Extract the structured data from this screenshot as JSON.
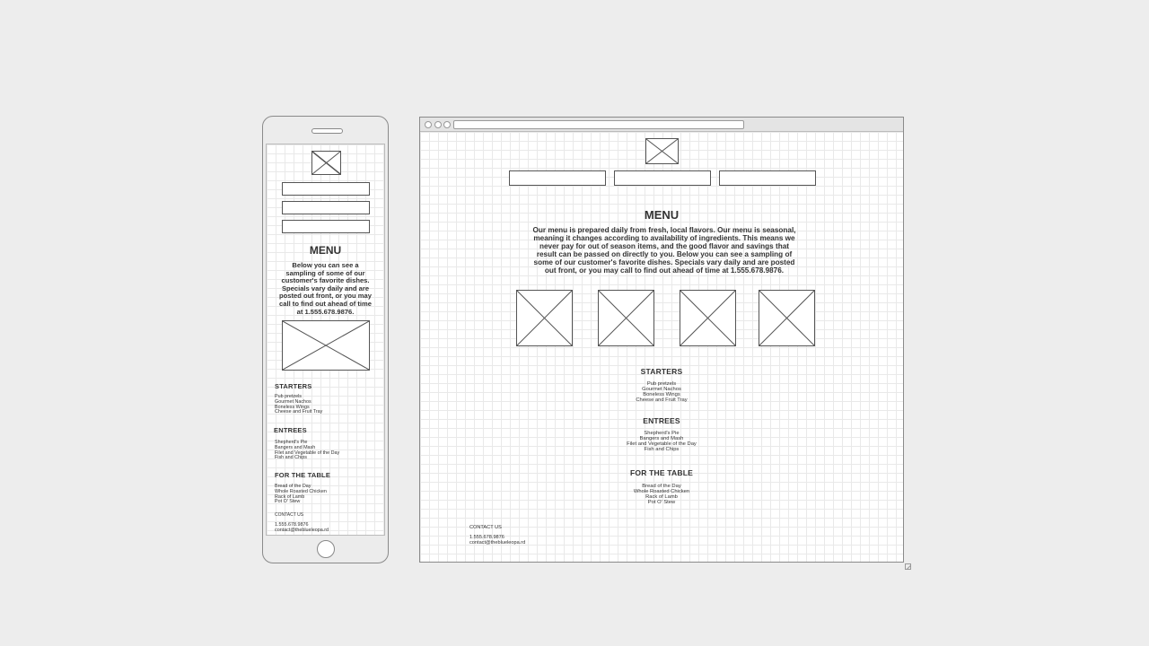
{
  "menu": {
    "title": "MENU",
    "mobile_intro": "Below you can see a sampling of some of our customer's favorite dishes. Specials vary daily and are posted out front, or you may call to find out ahead of time at 1.555.678.9876.",
    "desktop_intro": "Our menu is prepared daily from fresh, local flavors. Our menu is seasonal, meaning it changes according to availability of ingredients. This means we never pay for out of season items, and the good flavor and savings that result can be passed on directly to you. Below you can see a sampling of some of our customer's favorite dishes. Specials vary daily and are posted out front, or you may call to find out ahead of time at 1.555.678.9876."
  },
  "sections": [
    {
      "heading": "STARTERS",
      "items": [
        "Pub pretzels",
        "Gourmet Nachos",
        "Boneless Wings",
        "Cheese and Fruit Tray"
      ]
    },
    {
      "heading": "ENTREES",
      "items": [
        "Shepherd's Pie",
        "Bangers and Mash",
        "Filet and Vegetable of the Day",
        "Fish and Chips"
      ]
    },
    {
      "heading": "FOR THE TABLE",
      "items": [
        "Bread of the Day",
        "Whole Roasted Chicken",
        "Rack of Lamb",
        "Pot O' Stew"
      ]
    }
  ],
  "contact": {
    "heading": "CONTACT US",
    "phone": "1.555.678.9876",
    "email": "contact@theblueleopa.rd"
  }
}
